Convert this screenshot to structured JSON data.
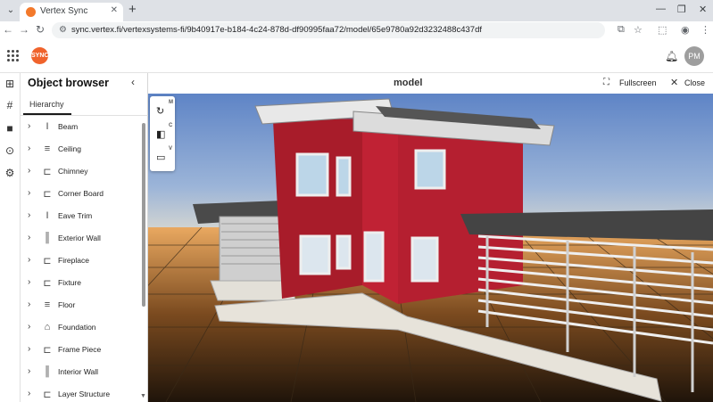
{
  "browser": {
    "tab_title": "Vertex Sync",
    "url": "sync.vertex.fi/vertexsystems-fi/9b40917e-b184-4c24-878d-df90995faa72/model/65e9780a92d3232488c437df"
  },
  "app": {
    "logo_text": "SYNC",
    "user_initials": "PM"
  },
  "panel": {
    "title": "Object browser",
    "tab": "Hierarchy",
    "items": [
      {
        "label": "Beam",
        "icon": "beam-icon"
      },
      {
        "label": "Ceiling",
        "icon": "ceiling-icon"
      },
      {
        "label": "Chimney",
        "icon": "chimney-icon"
      },
      {
        "label": "Corner Board",
        "icon": "corner-board-icon"
      },
      {
        "label": "Eave Trim",
        "icon": "eave-trim-icon"
      },
      {
        "label": "Exterior Wall",
        "icon": "wall-icon"
      },
      {
        "label": "Fireplace",
        "icon": "fireplace-icon"
      },
      {
        "label": "Fixture",
        "icon": "fixture-icon"
      },
      {
        "label": "Floor",
        "icon": "floor-icon"
      },
      {
        "label": "Foundation",
        "icon": "foundation-icon"
      },
      {
        "label": "Frame Piece",
        "icon": "frame-piece-icon"
      },
      {
        "label": "Interior Wall",
        "icon": "wall-icon"
      },
      {
        "label": "Layer Structure",
        "icon": "layer-icon"
      }
    ]
  },
  "viewer": {
    "title": "model",
    "fullscreen_label": "Fullscreen",
    "close_label": "Close",
    "tools": [
      {
        "name": "orbit-tool",
        "icon": "orbit-icon",
        "key": "M"
      },
      {
        "name": "clip-tool",
        "icon": "clip-icon",
        "key": "C"
      },
      {
        "name": "measure-tool",
        "icon": "ruler-icon",
        "key": "V"
      }
    ]
  }
}
